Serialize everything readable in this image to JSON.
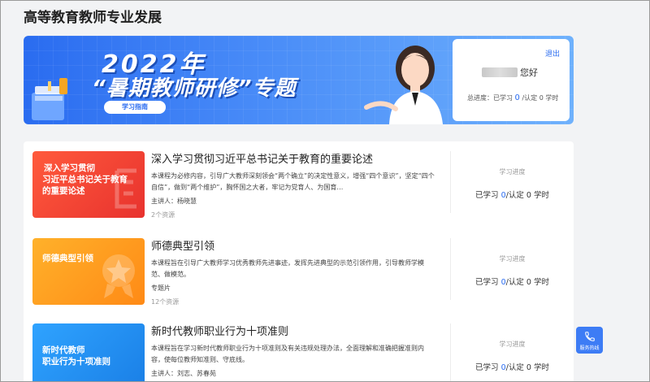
{
  "page": {
    "title": "高等教育教师专业发展"
  },
  "banner": {
    "year": "2022年",
    "topic": "“暑期教师研修”专题",
    "guide_label": "学习指南"
  },
  "user_card": {
    "logout": "退出",
    "greeting": "您好",
    "progress_prefix": "总进度：已学习",
    "learned": "0",
    "separator": " /认定",
    "certified": "0",
    "unit": "学时"
  },
  "courses": [
    {
      "thumb_lines": [
        "深入学习贯彻",
        "习近平总书记关于教育",
        "的重要论述"
      ],
      "name": "深入学习贯彻习近平总书记关于教育的重要论述",
      "desc": "本课程为必修内容，引导广大教师深刻领会“两个确立”的决定性意义，增强“四个意识”，坚定“四个自信”，做到“两个维护”，胸怀国之大者，牢记为党育人、为国育…",
      "meta": "主讲人：杨晓慧",
      "resources": "2个资源",
      "progress_label": "学习进度",
      "progress_prefix": "已学习",
      "learned": "0",
      "separator": "/认定",
      "certified": "0",
      "unit": "学时"
    },
    {
      "thumb_lines": [
        "师德典型引领"
      ],
      "name": "师德典型引领",
      "desc": "本课程旨在引导广大教师学习优秀教师先进事迹，发挥先进典型的示范引领作用，引导教师学模范、做模范。",
      "meta": "专题片",
      "resources": "12个资源",
      "progress_label": "学习进度",
      "progress_prefix": "已学习",
      "learned": "0",
      "separator": "/认定",
      "certified": "0",
      "unit": "学时"
    },
    {
      "thumb_lines": [
        "新时代教师",
        "职业行为十项准则"
      ],
      "name": "新时代教师职业行为十项准则",
      "desc": "本课程旨在学习新时代教师职业行为十项准则及有关违规处理办法，全面理解和准确把握准则内容，使每位教师知准则、守底线。",
      "meta": "主讲人：刘志、苏春苑",
      "resources": "",
      "progress_label": "学习进度",
      "progress_prefix": "已学习",
      "learned": "0",
      "separator": "/认定",
      "certified": "0",
      "unit": "学时"
    }
  ],
  "service": {
    "label": "服务热线",
    "icon": "phone-icon"
  },
  "colors": {
    "accent": "#2a6cf0",
    "thumb1": "#f0433a",
    "thumb2": "#ff9a1e",
    "thumb3": "#2b8ef0"
  }
}
